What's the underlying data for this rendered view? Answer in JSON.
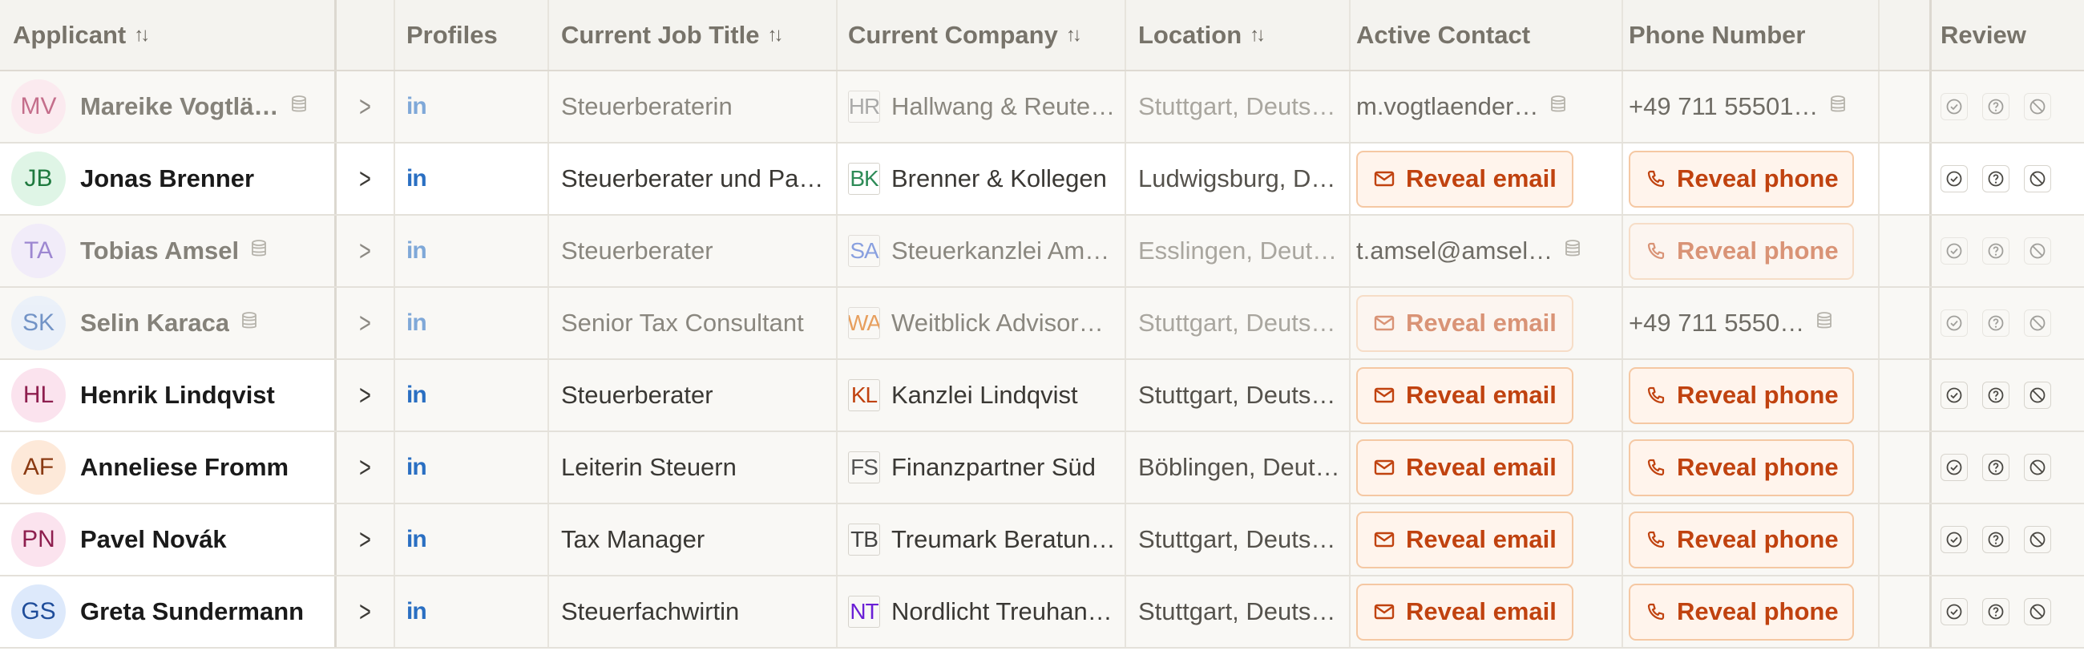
{
  "headers": {
    "applicant": "Applicant",
    "profiles": "Profiles",
    "job_title": "Current Job Title",
    "company": "Current Company",
    "location": "Location",
    "active_contact": "Active Contact",
    "phone": "Phone Number",
    "review": "Review"
  },
  "reveal_email_label": "Reveal email",
  "reveal_phone_label": "Reveal phone",
  "linkedin_label": "in",
  "colors": {
    "accent": "#c0420f",
    "reveal_bg": "#fff4ec",
    "reveal_border": "#f5c8a3",
    "linkedin": "#2a6fc2"
  },
  "rows": [
    {
      "initials": "MV",
      "avatar_bg": "#fde6ee",
      "avatar_fg": "#b03a63",
      "name": "Mareike Vogtlä…",
      "state": "dim",
      "job_title": "Steuerberaterin",
      "company_logo": "HR",
      "logo_color": "#8a8a8a",
      "company": "Hallwang & Reute…",
      "location": "Stuttgart, Deuts…",
      "email": "m.vogtlaender…",
      "phone": "+49 711 55501…"
    },
    {
      "initials": "JB",
      "avatar_bg": "#dff5e6",
      "avatar_fg": "#1f7a3f",
      "name": "Jonas Brenner",
      "state": "active",
      "job_title": "Steuerberater und Pa…",
      "company_logo": "BK",
      "logo_color": "#2e8b57",
      "company": "Brenner & Kollegen",
      "location": "Ludwigsburg, D…",
      "email": null,
      "phone": null
    },
    {
      "initials": "TA",
      "avatar_bg": "#efe8fb",
      "avatar_fg": "#7a5cc4",
      "name": "Tobias Amsel",
      "state": "dim",
      "job_title": "Steuerberater",
      "company_logo": "SA",
      "logo_color": "#5b7bd6",
      "company": "Steuerkanzlei Am…",
      "location": "Esslingen, Deut…",
      "email": "t.amsel@amsel…",
      "phone": null
    },
    {
      "initials": "SK",
      "avatar_bg": "#e5eefb",
      "avatar_fg": "#3f6db5",
      "name": "Selin Karaca",
      "state": "dim",
      "job_title": "Senior Tax Consultant",
      "company_logo": "WA",
      "logo_color": "#e07a1f",
      "company": "Weitblick Advisor…",
      "location": "Stuttgart, Deuts…",
      "email": null,
      "phone": "+49 711 5550…"
    },
    {
      "initials": "HL",
      "avatar_bg": "#fbe3ee",
      "avatar_fg": "#8e1f4f",
      "name": "Henrik Lindqvist",
      "state": "normal",
      "job_title": "Steuerberater",
      "company_logo": "KL",
      "logo_color": "#c0420f",
      "company": "Kanzlei Lindqvist",
      "location": "Stuttgart, Deuts…",
      "email": null,
      "phone": null
    },
    {
      "initials": "AF",
      "avatar_bg": "#fde9d9",
      "avatar_fg": "#8a3a12",
      "name": "Anneliese Fromm",
      "state": "normal",
      "job_title": "Leiterin Steuern",
      "company_logo": "FS",
      "logo_color": "#555555",
      "company": "Finanzpartner Süd",
      "location": "Böblingen, Deut…",
      "email": null,
      "phone": null
    },
    {
      "initials": "PN",
      "avatar_bg": "#fbe3ee",
      "avatar_fg": "#8e1f4f",
      "name": "Pavel Novák",
      "state": "normal",
      "job_title": "Tax Manager",
      "company_logo": "TB",
      "logo_color": "#444444",
      "company": "Treumark Beratun…",
      "location": "Stuttgart, Deuts…",
      "email": null,
      "phone": null
    },
    {
      "initials": "GS",
      "avatar_bg": "#dde9fb",
      "avatar_fg": "#1f4d9a",
      "name": "Greta Sundermann",
      "state": "normal",
      "job_title": "Steuerfachwirtin",
      "company_logo": "NT",
      "logo_color": "#6a1fd6",
      "company": "Nordlicht Treuhan…",
      "location": "Stuttgart, Deuts…",
      "email": null,
      "phone": null
    }
  ]
}
